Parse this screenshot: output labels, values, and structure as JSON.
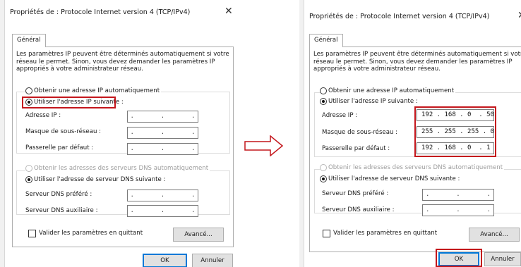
{
  "dialog_title": "Propriétés de : Protocole Internet version 4 (TCP/IPv4)",
  "tab_label": "Général",
  "description": [
    "Les paramètres IP peuvent être déterminés automatiquement si votre",
    "réseau le permet. Sinon, vous devez demander les paramètres IP",
    "appropriés à votre administrateur réseau."
  ],
  "radio_auto_ip": "Obtenir une adresse IP automatiquement",
  "radio_manual_ip": "Utiliser l'adresse IP suivante :",
  "label_ip": "Adresse IP :",
  "label_mask": "Masque de sous-réseau :",
  "label_gateway": "Passerelle par défaut :",
  "radio_auto_dns": "Obtenir les adresses des serveurs DNS automatiquement",
  "radio_manual_dns": "Utiliser l'adresse de serveur DNS suivante :",
  "label_dns_pref": "Serveur DNS préféré :",
  "label_dns_aux": "Serveur DNS auxiliaire :",
  "checkbox_validate": "Valider les paramètres en quittant",
  "button_advanced": "Avancé...",
  "button_ok": "OK",
  "button_cancel": "Annuler",
  "close_glyph": "✕",
  "empty_ip": ".       .       .",
  "ip_values": {
    "address": "192 . 168 . 0  . 50",
    "mask": "255 . 255 . 255 . 0",
    "gateway": "192 . 168 . 0  . 1"
  },
  "highlight_color": "#c4161c"
}
